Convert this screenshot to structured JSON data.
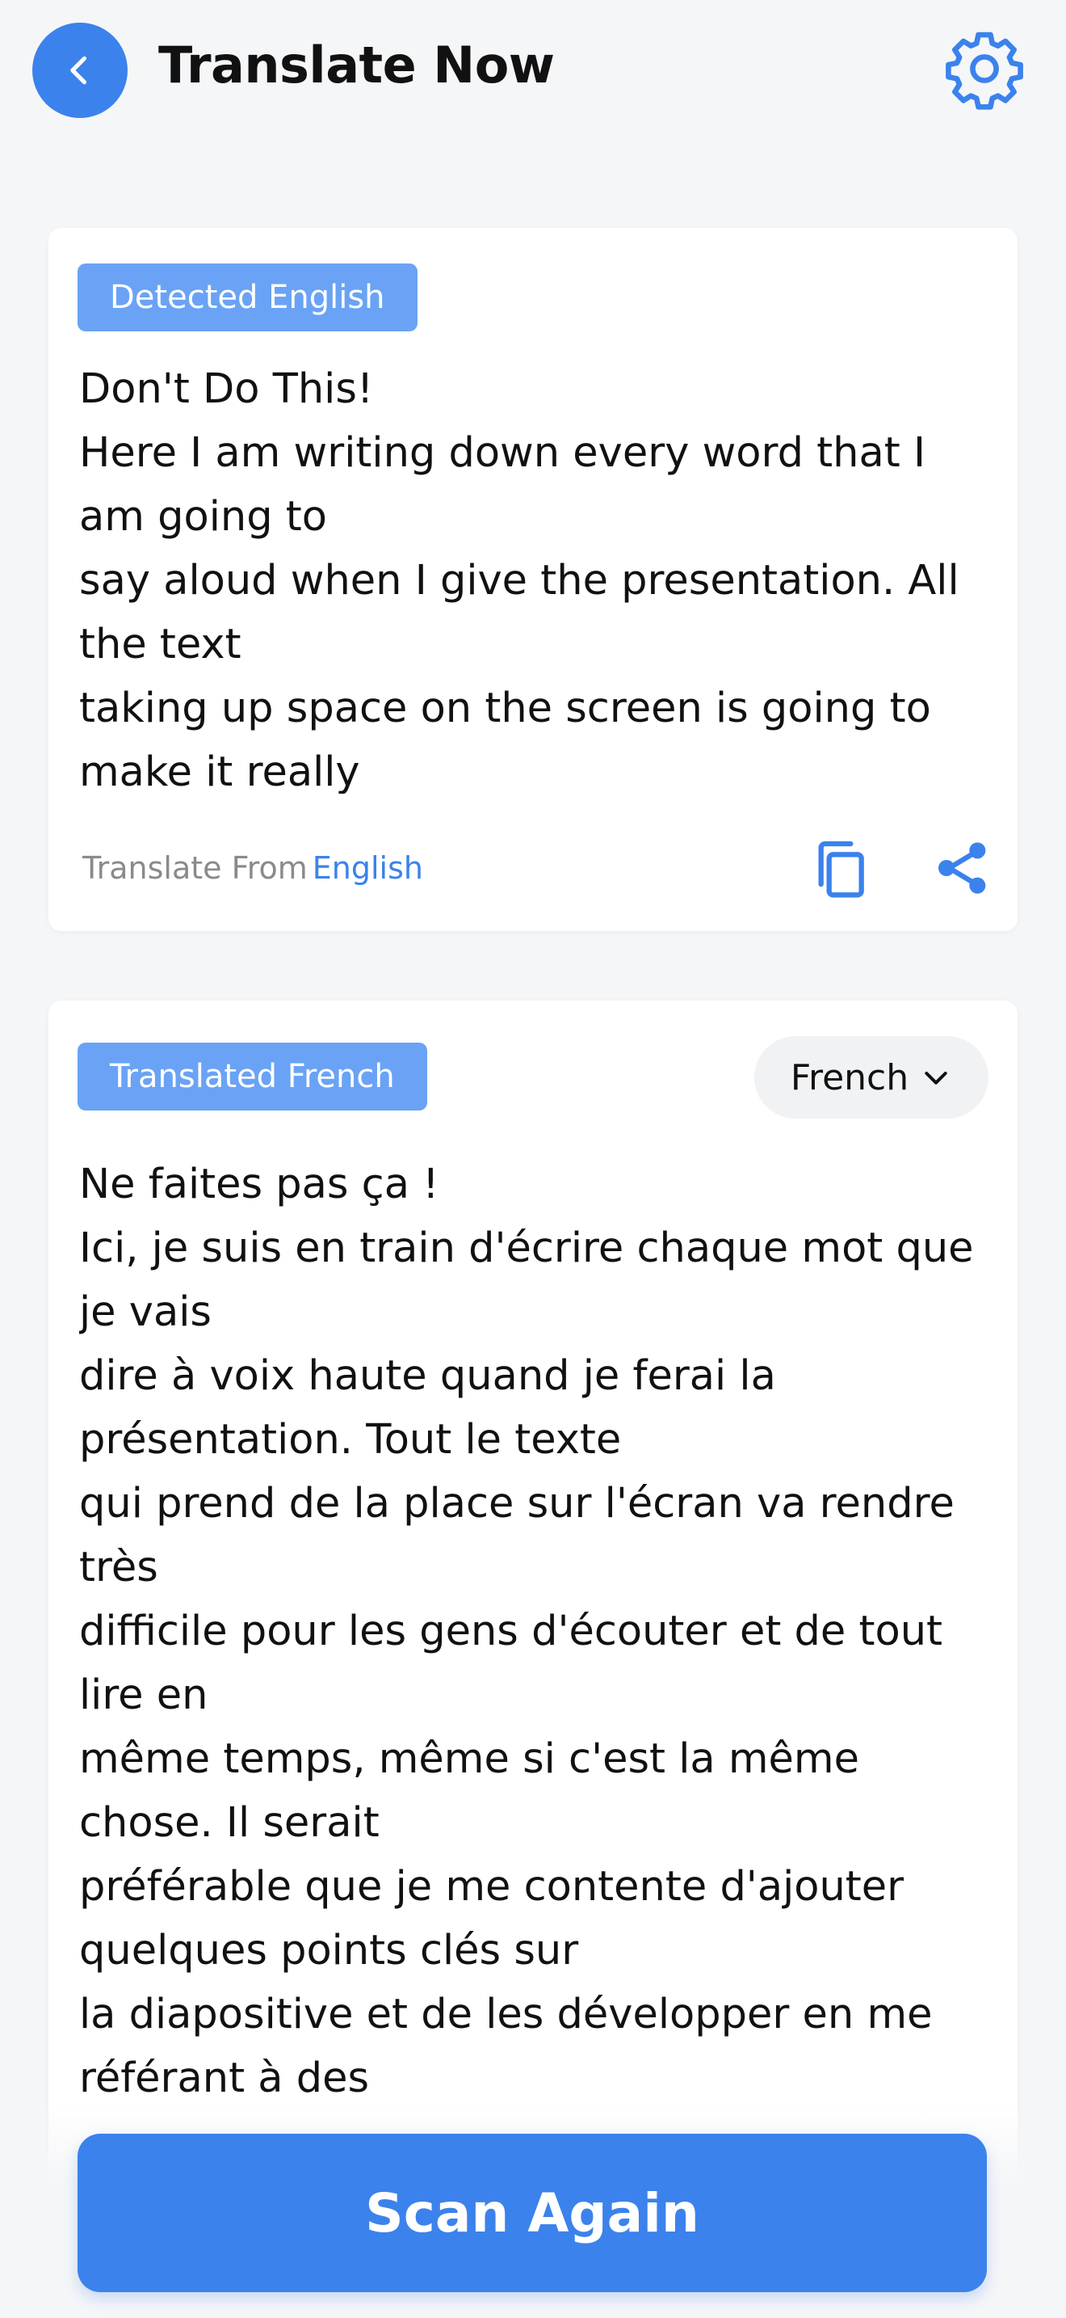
{
  "header": {
    "title": "Translate Now"
  },
  "source_card": {
    "badge": "Detected English",
    "text": "Don't Do This!\nHere I am writing down every word that I am going to\nsay aloud when I give the presentation. All the text\ntaking up space on the screen is going to make it really",
    "footer_label": "Translate From",
    "footer_language": "English"
  },
  "target_card": {
    "badge": "Translated French",
    "language_selector": "French",
    "text": "Ne faites pas ça !\nIci, je suis en train d'écrire chaque mot que je vais\ndire à voix haute quand je ferai la présentation. Tout le texte\nqui prend de la place sur l'écran va rendre très\ndifficile pour les gens d'écouter et de tout lire en\nmême temps, même si c'est la même chose. Il serait\npréférable que je me contente d'ajouter quelques points clés sur\nla diapositive et de les développer en me référant à des"
  },
  "actions": {
    "scan_again": "Scan Again"
  },
  "icons": {
    "back": "back-arrow-icon",
    "settings": "gear-icon",
    "copy": "copy-icon",
    "share": "share-icon",
    "dropdown": "chevron-down-icon"
  },
  "colors": {
    "accent": "#3b82ec",
    "badge": "#6aa3f5",
    "background": "#f5f6f8"
  }
}
